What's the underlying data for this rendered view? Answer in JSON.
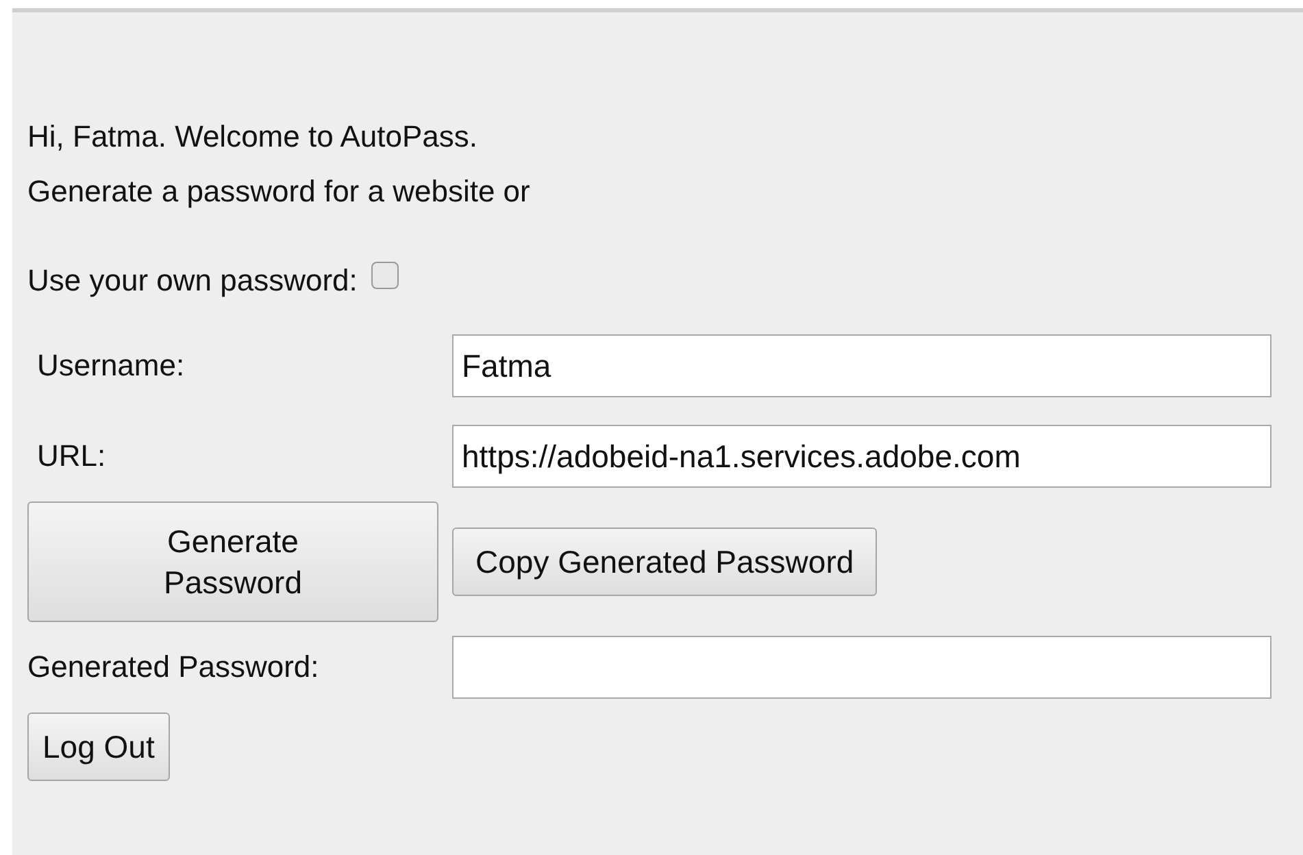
{
  "greeting": "Hi, Fatma. Welcome to AutoPass.",
  "intro": "Generate a password for a website or",
  "own_password": {
    "label": "Use your own password:",
    "checked": false
  },
  "fields": [
    {
      "label": "Username:",
      "value": "Fatma"
    },
    {
      "label": "URL:",
      "value": "https://adobeid-na1.services.adobe.com"
    }
  ],
  "generate_button": "Generate Password",
  "copy_button": "Copy Generated Password",
  "generated_password": {
    "label": "Generated Password:"
  },
  "logout_button": "Log Out"
}
